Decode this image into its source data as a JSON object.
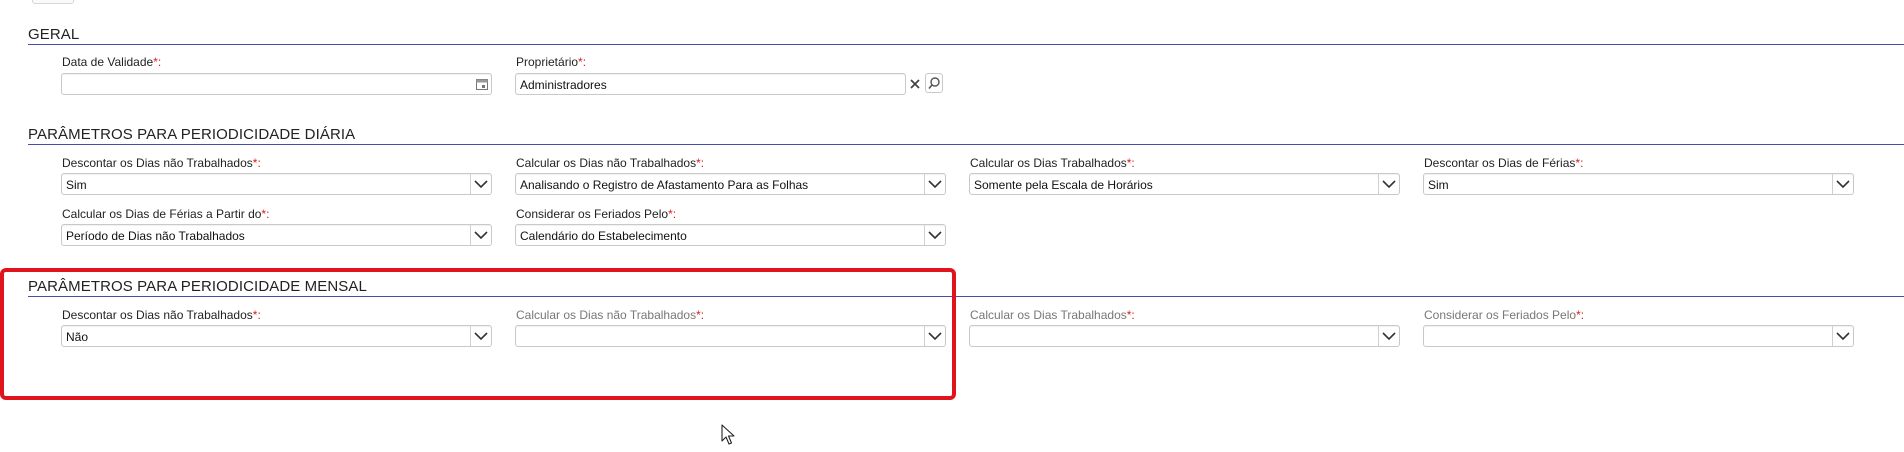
{
  "sections": {
    "geral": {
      "title": "GERAL",
      "data_validade": {
        "label": "Data de Validade",
        "value": ""
      },
      "proprietario": {
        "label": "Proprietário",
        "value": "Administradores"
      }
    },
    "diaria": {
      "title": "PARÂMETROS PARA PERIODICIDADE DIÁRIA",
      "descontar_dias_nao_trab": {
        "label": "Descontar os Dias não Trabalhados",
        "value": "Sim"
      },
      "calcular_dias_nao_trab": {
        "label": "Calcular os Dias não Trabalhados",
        "value": "Analisando o Registro de Afastamento Para as Folhas"
      },
      "calcular_dias_trab": {
        "label": "Calcular os Dias Trabalhados",
        "value": "Somente pela Escala de Horários"
      },
      "descontar_dias_ferias": {
        "label": "Descontar os Dias de Férias",
        "value": "Sim"
      },
      "calcular_ferias_partir": {
        "label": "Calcular os Dias de Férias a Partir do",
        "value": "Período de Dias não Trabalhados"
      },
      "considerar_feriados": {
        "label": "Considerar os Feriados Pelo",
        "value": "Calendário do Estabelecimento"
      }
    },
    "mensal": {
      "title": "PARÂMETROS PARA PERIODICIDADE MENSAL",
      "descontar_dias_nao_trab": {
        "label": "Descontar os Dias não Trabalhados",
        "value": "Não"
      },
      "calcular_dias_nao_trab": {
        "label": "Calcular os Dias não Trabalhados",
        "value": ""
      },
      "calcular_dias_trab": {
        "label": "Calcular os Dias Trabalhados",
        "value": ""
      },
      "considerar_feriados": {
        "label": "Considerar os Feriados Pelo",
        "value": ""
      }
    }
  },
  "required_mark": "*:",
  "colors": {
    "section_line": "#4a4aa8",
    "required": "#d42020",
    "highlight": "#e0141c"
  }
}
